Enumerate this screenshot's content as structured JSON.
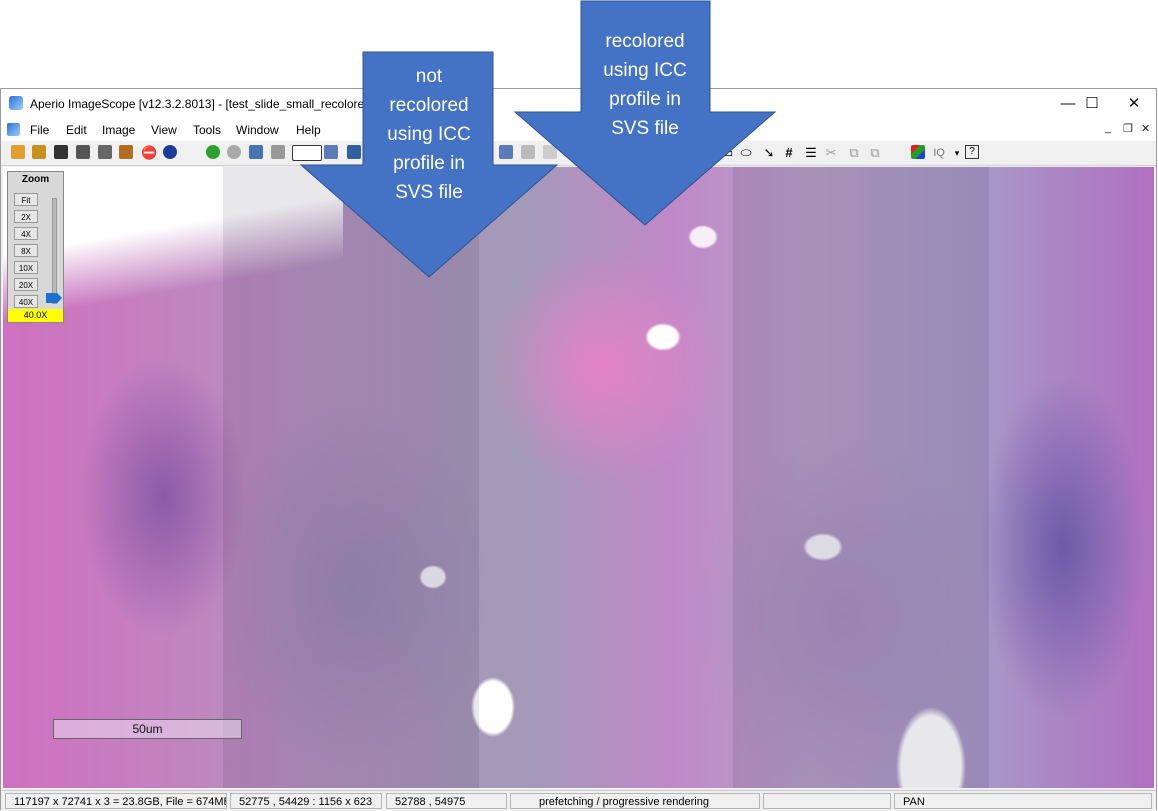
{
  "window": {
    "title": "Aperio ImageScope [v12.3.2.8013] - [test_slide_small_recolored.svs -",
    "controls": {
      "minimize": "—",
      "maximize": "☐",
      "close": "✕"
    }
  },
  "menu": {
    "items": [
      "File",
      "Edit",
      "Image",
      "View",
      "Tools",
      "Window",
      "Help"
    ],
    "mdi": {
      "minimize": "_",
      "restore": "❐",
      "close": "✕"
    }
  },
  "toolbar": {
    "icons": [
      "open-folder",
      "open-folder-yellow",
      "camera",
      "snapshot",
      "print",
      "export",
      "chart",
      "info",
      "back",
      "forward",
      "network",
      "network-gray",
      "color-selector",
      "zoom-fit",
      "annotation",
      "rect",
      "ellipse",
      "arrow",
      "grid",
      "text",
      "ruler",
      "copy",
      "paste",
      "color-adjust",
      "iq",
      "help"
    ]
  },
  "zoom_panel": {
    "title": "Zoom",
    "buttons": [
      "Fit",
      "2X",
      "4X",
      "8X",
      "10X",
      "20X",
      "40X"
    ],
    "current": "40.0X",
    "level_fraction": 1.0
  },
  "viewer": {
    "scalebar_label": "50um"
  },
  "status": {
    "image_info": "117197 x 72741 x 3 = 23.8GB, File = 674MB",
    "view_region": "52775 , 54429 : 1156 x 623",
    "cursor": "52788 , 54975",
    "rendering": "prefetching / progressive rendering",
    "empty": "",
    "mode": "PAN"
  },
  "callouts": {
    "left": [
      "not",
      "recolored",
      "using ICC",
      "profile in",
      "SVS file"
    ],
    "right": [
      "recolored",
      "using ICC",
      "profile in",
      "SVS file"
    ],
    "fill_color": "#4472c4"
  }
}
